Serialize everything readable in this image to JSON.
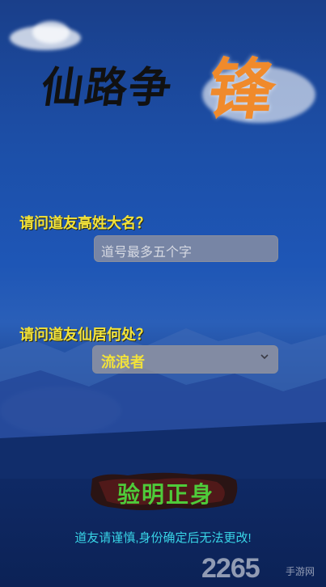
{
  "title": {
    "part1": "仙路争",
    "part2": "锋"
  },
  "form": {
    "name_question": "请问道友高姓大名？",
    "name_placeholder": "道号最多五个字",
    "home_question": "请问道友仙居何处？",
    "home_selected": "流浪者"
  },
  "confirm_button": "验明正身",
  "warning_text": "道友请谨慎,身份确定后无法更改!",
  "watermark": {
    "number": "2265",
    "suffix": "手游网"
  },
  "colors": {
    "question": "#f2e23a",
    "confirm": "#4ecb3a",
    "warning": "#38d4e6",
    "title_accent": "#f08a2b"
  }
}
